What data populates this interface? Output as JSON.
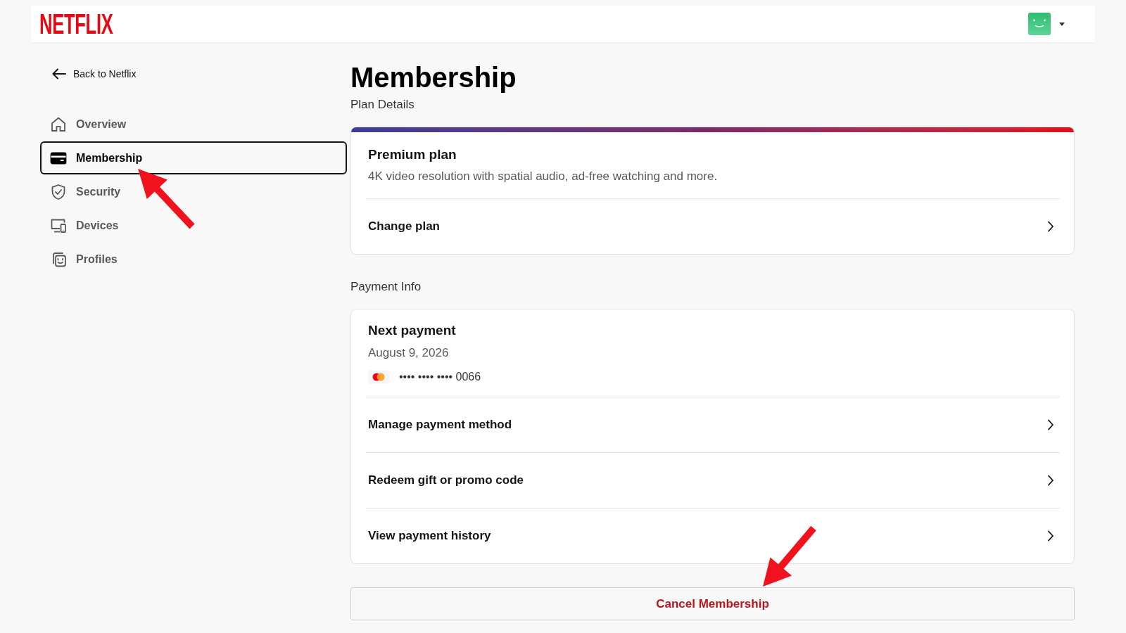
{
  "header": {
    "logo": "NETFLIX"
  },
  "sidebar": {
    "back_link": "Back to Netflix",
    "items": [
      {
        "label": "Overview",
        "selected": false
      },
      {
        "label": "Membership",
        "selected": true
      },
      {
        "label": "Security",
        "selected": false
      },
      {
        "label": "Devices",
        "selected": false
      },
      {
        "label": "Profiles",
        "selected": false
      }
    ]
  },
  "main": {
    "title": "Membership",
    "plan_details": {
      "label": "Plan Details",
      "plan_name": "Premium plan",
      "plan_description": "4K video resolution with spatial audio, ad-free watching and more.",
      "actions": [
        "Change plan"
      ]
    },
    "payment_info": {
      "label": "Payment Info",
      "next_payment_title": "Next payment",
      "next_payment_date": "August 9, 2026",
      "card_number": "•••• •••• •••• 0066",
      "actions": [
        "Manage payment method",
        "Redeem gift or promo code",
        "View payment history"
      ]
    },
    "cancel_button": "Cancel Membership"
  }
}
